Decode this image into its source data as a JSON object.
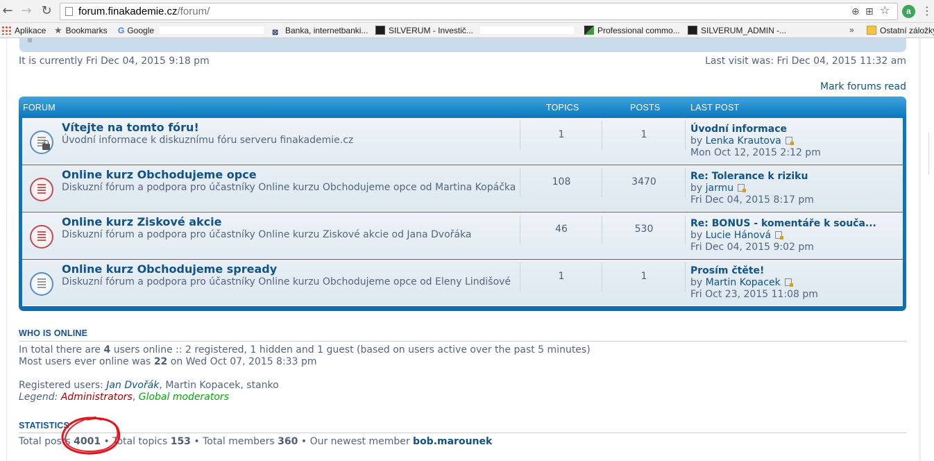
{
  "browser": {
    "url_host": "forum.finakademie.cz",
    "url_path": "/forum/",
    "nav": {
      "back": "←",
      "forward": "→",
      "reload": "↻"
    },
    "bookmarks": [
      {
        "label": "Aplikace",
        "icon": "apps-icon"
      },
      {
        "label": "Bookmarks",
        "icon": "star-icon"
      },
      {
        "label": "Google",
        "icon": "google-icon"
      },
      {
        "label": "Banka, internetbanki...",
        "icon": "bank-icon"
      },
      {
        "label": "SILVERUM - Investič...",
        "icon": "silverum-icon"
      },
      {
        "label": "Professional commo...",
        "icon": "professional-icon"
      },
      {
        "label": "SILVERUM_ADMIN -...",
        "icon": "silverum-icon"
      }
    ],
    "more_bookmarks": "»",
    "other_bookmarks": "Ostatní záložky",
    "extension_letter": "a"
  },
  "header": {
    "current_time": "It is currently Fri Dec 04, 2015 9:18 pm",
    "last_visit": "Last visit was: Fri Dec 04, 2015 11:32 am",
    "mark_forums_read": "Mark forums read"
  },
  "forum_table": {
    "headers": {
      "forum": "FORUM",
      "topics": "TOPICS",
      "posts": "POSTS",
      "last_post": "LAST POST"
    },
    "rows": [
      {
        "title": "Vítejte na tomto fóru!",
        "description": "Úvodní informace k diskuznímu fóru serveru finakademie.cz",
        "topics": "1",
        "posts": "1",
        "last_post_title": "Úvodní informace",
        "by": "by",
        "last_post_user": "Lenka Krautova",
        "last_post_date": "Mon Oct 12, 2015 2:12 pm",
        "icon": "forum-read-locked-icon"
      },
      {
        "title": "Online kurz Obchodujeme opce",
        "description": "Diskuzní fórum a podpora pro účastníky Online kurzu Obchodujeme opce od Martina Kopáčka",
        "topics": "108",
        "posts": "3470",
        "last_post_title": "Re: Tolerance k riziku",
        "by": "by",
        "last_post_user": "jarmu",
        "last_post_date": "Fri Dec 04, 2015 8:17 pm",
        "icon": "forum-unread-icon"
      },
      {
        "title": "Online kurz Ziskové akcie",
        "description": "Diskuzní fórum a podpora pro účastníky Online kurzu Ziskové akcie od Jana Dvořáka",
        "topics": "46",
        "posts": "530",
        "last_post_title": "Re: BONUS - komentáře k souča...",
        "by": "by",
        "last_post_user": "Lucie Hánová",
        "last_post_date": "Fri Dec 04, 2015 9:02 pm",
        "icon": "forum-unread-icon"
      },
      {
        "title": "Online kurz Obchodujeme spready",
        "description": "Diskuzní fórum a podpora pro účastníky Online kurzu Obchodujeme opce od Eleny Lindišové",
        "topics": "1",
        "posts": "1",
        "last_post_title": "Prosím čtěte!",
        "by": "by",
        "last_post_user": "Martin Kopacek",
        "last_post_date": "Fri Oct 23, 2015 11:08 pm",
        "icon": "forum-read-icon"
      }
    ]
  },
  "who_is_online": {
    "heading": "WHO IS ONLINE",
    "total_prefix": "In total there are",
    "total_count": "4",
    "total_suffix": "users online :: 2 registered, 1 hidden and 1 guest (based on users active over the past 5 minutes)",
    "most_prefix": "Most users ever online was",
    "most_count": "22",
    "most_suffix": "on Wed Oct 07, 2015 8:33 pm",
    "registered_label": "Registered users:",
    "registered_users": [
      "Jan Dvořák",
      "Martin Kopacek",
      "stanko"
    ],
    "legend_label": "Legend:",
    "legend_admin": "Administrators",
    "legend_mod": "Global moderators"
  },
  "statistics": {
    "heading": "STATISTICS",
    "total_posts_label": "Total posts",
    "total_posts": "4001",
    "total_topics_label": "Total topics",
    "total_topics": "153",
    "total_members_label": "Total members",
    "total_members": "360",
    "newest_label": "Our newest member",
    "newest_member": "bob.marounek"
  },
  "colors": {
    "accent": "#0b78c0",
    "link": "#105289",
    "text": "#536482",
    "annotation": "#e0141e"
  }
}
